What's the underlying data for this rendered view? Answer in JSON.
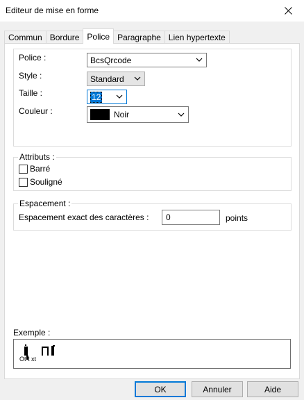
{
  "window": {
    "title": "Editeur de mise en forme"
  },
  "tabs": [
    {
      "label": "Commun"
    },
    {
      "label": "Bordure"
    },
    {
      "label": "Police"
    },
    {
      "label": "Paragraphe"
    },
    {
      "label": "Lien hypertexte"
    }
  ],
  "font": {
    "police_label": "Police :",
    "police_value": "BcsQrcode",
    "style_label": "Style :",
    "style_value": "Standard",
    "taille_label": "Taille :",
    "taille_value": "12",
    "couleur_label": "Couleur :",
    "couleur_value": "Noir",
    "couleur_hex": "#000000"
  },
  "attributs": {
    "title": "Attributs :",
    "barre_label": "Barré",
    "souligne_label": "Souligné"
  },
  "espacement": {
    "title": "Espacement :",
    "exact_label": "Espacement exact des caractères :",
    "value": "0",
    "unit": "points"
  },
  "exemple": {
    "label": "Exemple :",
    "text": "Ot t xt"
  },
  "buttons": {
    "ok": "OK",
    "cancel": "Annuler",
    "help": "Aide"
  }
}
